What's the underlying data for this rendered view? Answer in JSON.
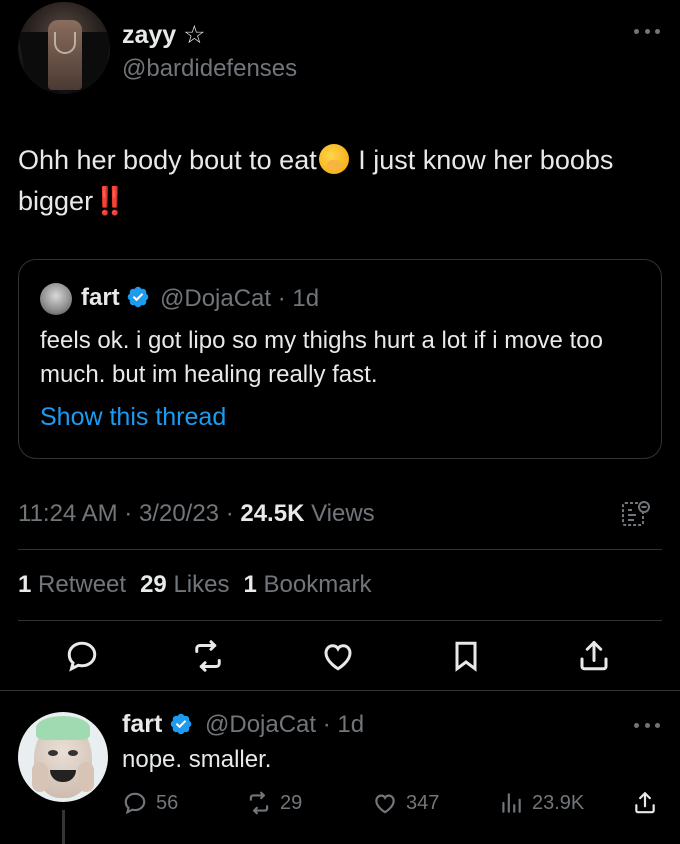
{
  "main_tweet": {
    "display_name": "zayy",
    "name_suffix": "☆",
    "handle": "@bardidefenses",
    "text_part1": "Ohh her body bout to eat",
    "text_part2": " I just know her boobs bigger",
    "bang": "‼️"
  },
  "quoted_tweet": {
    "display_name": "fart",
    "handle_time": "@DojaCat · 1d",
    "text": "feels ok. i got lipo so my thighs hurt a lot if i move too much. but im healing really fast.",
    "show_thread": "Show this thread"
  },
  "meta": {
    "time_date": "11:24 AM · 3/20/23 · ",
    "views_count": "24.5K",
    "views_label": " Views"
  },
  "stats": {
    "retweets_count": "1",
    "retweets_label": " Retweet",
    "likes_count": "29",
    "likes_label": " Likes",
    "bookmarks_count": "1",
    "bookmarks_label": " Bookmark"
  },
  "reply": {
    "display_name": "fart",
    "handle_time": "@DojaCat · 1d",
    "text": "nope. smaller.",
    "replies": "56",
    "retweets": "29",
    "likes": "347",
    "views": "23.9K"
  },
  "colors": {
    "background": "#000000",
    "text": "#e7e9ea",
    "secondary": "#71767b",
    "link": "#1d9bf0",
    "divider": "#2f3336"
  }
}
